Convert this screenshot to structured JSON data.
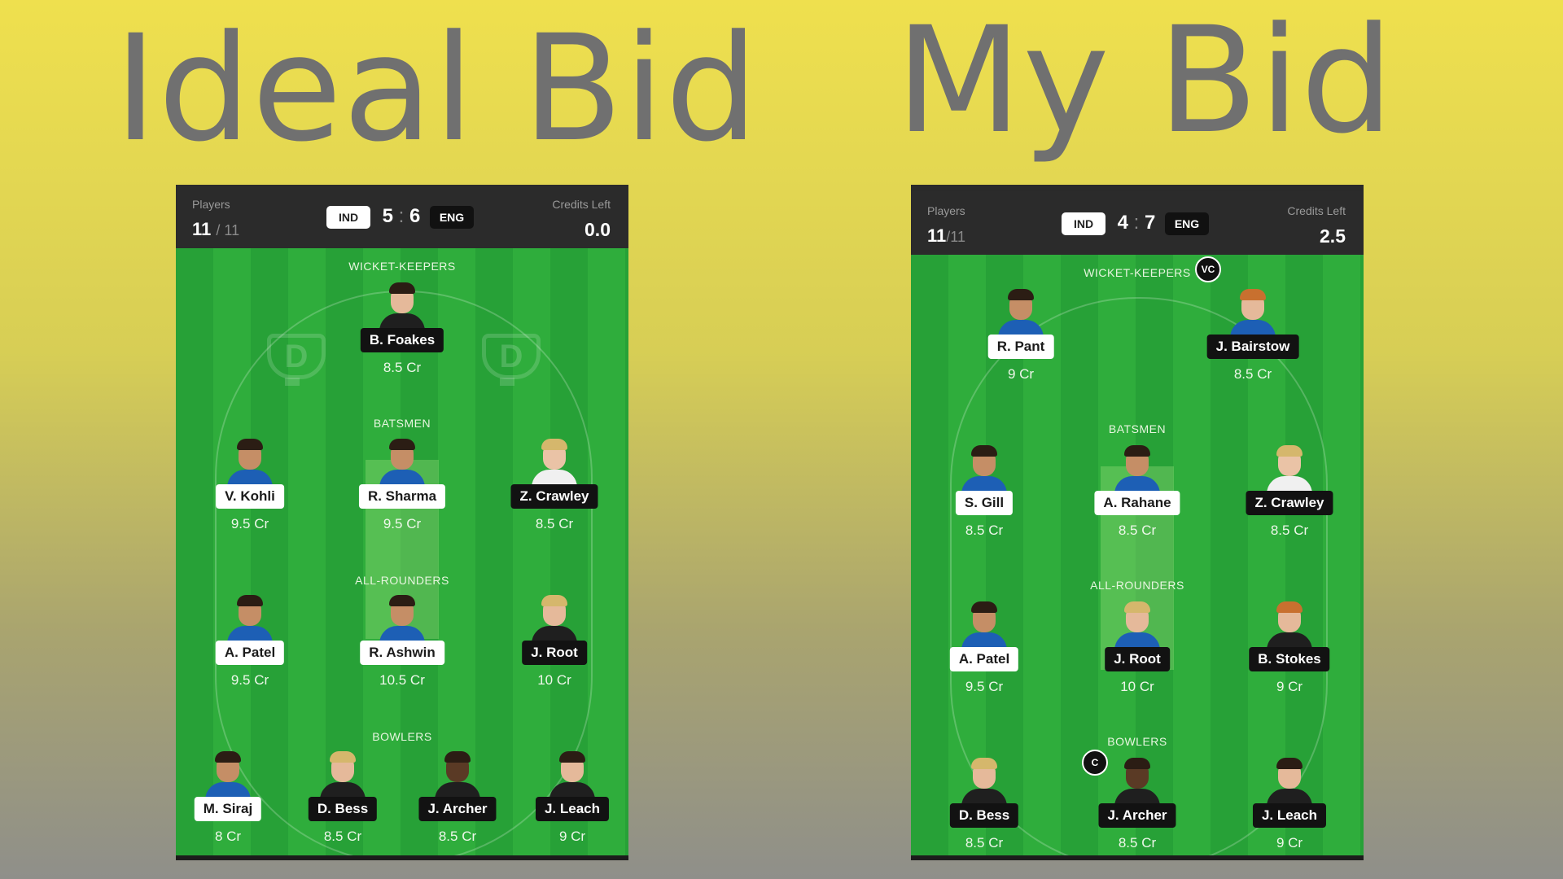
{
  "titles": {
    "ideal": "Ideal Bid",
    "my": "My Bid"
  },
  "ideal": {
    "header": {
      "players_label": "Players",
      "players_count": "11",
      "players_total": "/ 11",
      "team1": "IND",
      "score1": "5",
      "score2": "6",
      "team2": "ENG",
      "credits_label": "Credits Left",
      "credits_value": "0.0"
    },
    "sections": {
      "wk": "WICKET-KEEPERS",
      "bat": "BATSMEN",
      "ar": "ALL-ROUNDERS",
      "bowl": "BOWLERS"
    },
    "players": {
      "wk1": {
        "name": "B. Foakes",
        "credits": "8.5 Cr"
      },
      "bat1": {
        "name": "V. Kohli",
        "credits": "9.5 Cr"
      },
      "bat2": {
        "name": "R. Sharma",
        "credits": "9.5 Cr"
      },
      "bat3": {
        "name": "Z. Crawley",
        "credits": "8.5 Cr"
      },
      "ar1": {
        "name": "A. Patel",
        "credits": "9.5 Cr"
      },
      "ar2": {
        "name": "R. Ashwin",
        "credits": "10.5 Cr"
      },
      "ar3": {
        "name": "J. Root",
        "credits": "10 Cr"
      },
      "bowl1": {
        "name": "M. Siraj",
        "credits": "8 Cr"
      },
      "bowl2": {
        "name": "D. Bess",
        "credits": "8.5 Cr"
      },
      "bowl3": {
        "name": "J. Archer",
        "credits": "8.5 Cr"
      },
      "bowl4": {
        "name": "J. Leach",
        "credits": "9 Cr"
      }
    }
  },
  "my": {
    "header": {
      "players_label": "Players",
      "players_count": "11",
      "players_total": "/11",
      "team1": "IND",
      "score1": "4",
      "score2": "7",
      "team2": "ENG",
      "credits_label": "Credits Left",
      "credits_value": "2.5"
    },
    "sections": {
      "wk": "WICKET-KEEPERS",
      "bat": "BATSMEN",
      "ar": "ALL-ROUNDERS",
      "bowl": "BOWLERS"
    },
    "badges": {
      "vc": "VC",
      "c": "C"
    },
    "players": {
      "wk1": {
        "name": "R. Pant",
        "credits": "9 Cr"
      },
      "wk2": {
        "name": "J. Bairstow",
        "credits": "8.5 Cr"
      },
      "bat1": {
        "name": "S. Gill",
        "credits": "8.5 Cr"
      },
      "bat2": {
        "name": "A. Rahane",
        "credits": "8.5 Cr"
      },
      "bat3": {
        "name": "Z. Crawley",
        "credits": "8.5 Cr"
      },
      "ar1": {
        "name": "A. Patel",
        "credits": "9.5 Cr"
      },
      "ar2": {
        "name": "J. Root",
        "credits": "10 Cr"
      },
      "ar3": {
        "name": "B. Stokes",
        "credits": "9 Cr"
      },
      "bowl1": {
        "name": "D. Bess",
        "credits": "8.5 Cr"
      },
      "bowl2": {
        "name": "J. Archer",
        "credits": "8.5 Cr"
      },
      "bowl3": {
        "name": "J. Leach",
        "credits": "9 Cr"
      }
    }
  }
}
